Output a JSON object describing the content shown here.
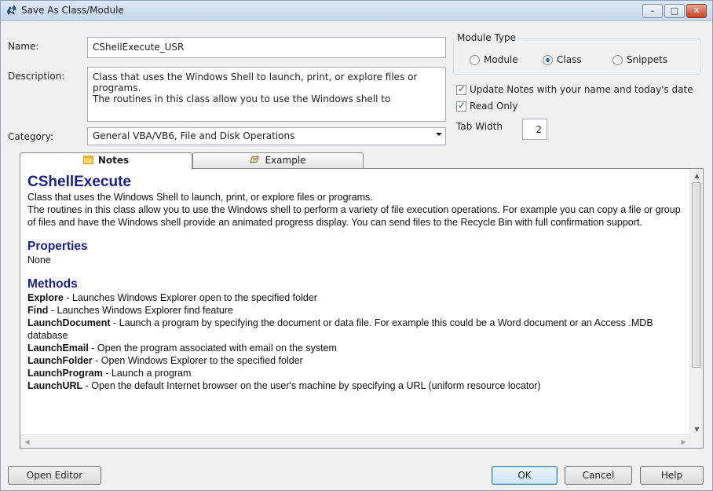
{
  "window": {
    "title": "Save As Class/Module",
    "minimize": "–",
    "maximize": "□",
    "close": "✕"
  },
  "form": {
    "name_label": "Name:",
    "name_value": "CShellExecute_USR",
    "description_label": "Description:",
    "description_value": "Class that uses the Windows Shell to launch, print, or explore files or programs.\nThe routines in this class allow you to use the Windows shell to",
    "category_label": "Category:",
    "category_value": "General VBA/VB6, File and Disk Operations"
  },
  "module_type": {
    "legend": "Module Type",
    "options": [
      {
        "label": "Module",
        "selected": false
      },
      {
        "label": "Class",
        "selected": true
      },
      {
        "label": "Snippets",
        "selected": false
      }
    ]
  },
  "options": {
    "update_notes_label": "Update Notes with your name and today's date",
    "update_notes_checked": true,
    "read_only_label": "Read Only",
    "read_only_checked": true,
    "tab_width_label": "Tab Width",
    "tab_width_value": "2"
  },
  "tabs": [
    {
      "label": "Notes",
      "active": true,
      "icon": "notes-icon"
    },
    {
      "label": "Example",
      "active": false,
      "icon": "example-icon"
    }
  ],
  "notes": {
    "heading": "CShellExecute",
    "intro_1": "Class that uses the Windows Shell to launch, print, or explore files or programs.",
    "intro_2": "The routines in this class allow you to use the Windows shell to perform a variety of file execution operations. For example you can copy a file or group of files and have the Windows shell provide an animated progress display. You can send files to the Recycle Bin with full confirmation support.",
    "properties_heading": "Properties",
    "properties_value": "None",
    "methods_heading": "Methods",
    "methods": [
      {
        "name": "Explore",
        "desc": " - Launches Windows Explorer open to the specified folder"
      },
      {
        "name": "Find",
        "desc": " - Launches Windows Explorer find feature"
      },
      {
        "name": "LaunchDocument",
        "desc": " - Launch a program by specifying the document or data file. For example this could be a Word document or an Access .MDB database"
      },
      {
        "name": "LaunchEmail",
        "desc": " - Open the program associated with email on the system"
      },
      {
        "name": "LaunchFolder",
        "desc": " - Open Windows Explorer to the specified folder"
      },
      {
        "name": "LaunchProgram",
        "desc": " - Launch a program"
      },
      {
        "name": "LaunchURL",
        "desc": " - Open the default Internet browser on the user's machine by specifying a URL (uniform resource locator)"
      }
    ]
  },
  "buttons": {
    "open_editor": "Open Editor",
    "ok": "OK",
    "cancel": "Cancel",
    "help": "Help"
  },
  "colors": {
    "heading": "#1b1f8a",
    "window_bg": "#f0f0f0"
  }
}
